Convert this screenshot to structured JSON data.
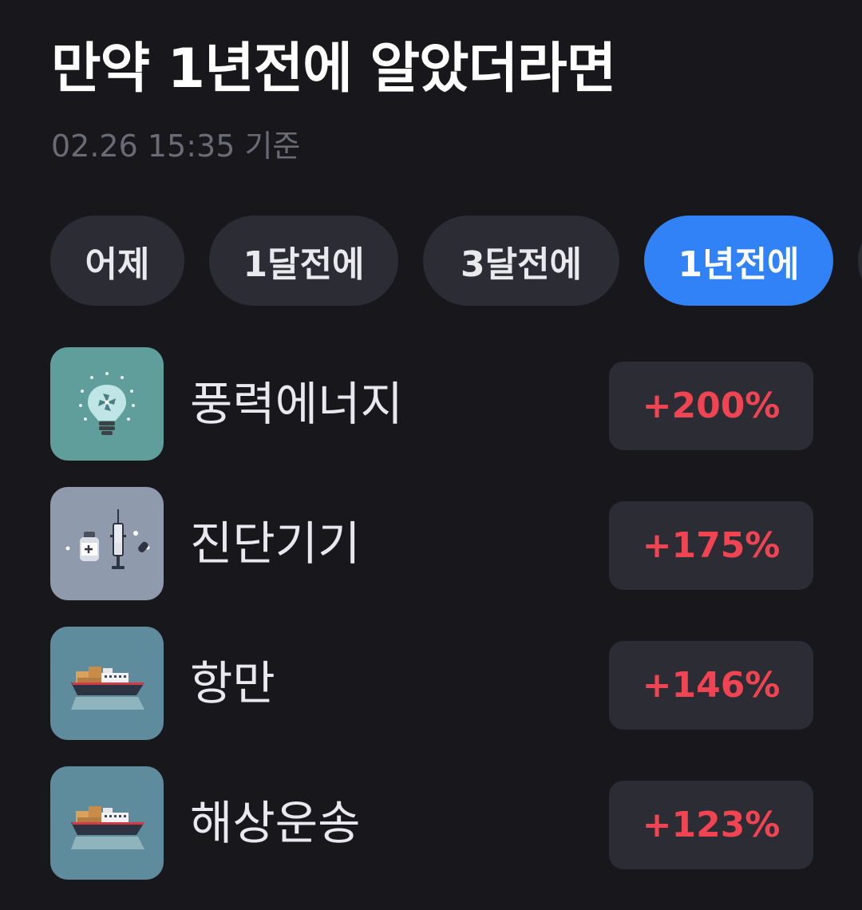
{
  "header": {
    "title": "만약 1년전에 알았더라면",
    "timestamp": "02.26 15:35 기준"
  },
  "tabs": [
    {
      "label": "어제",
      "active": false
    },
    {
      "label": "1달전에",
      "active": false
    },
    {
      "label": "3달전에",
      "active": false
    },
    {
      "label": "1년전에",
      "active": true
    }
  ],
  "items": [
    {
      "name": "풍력에너지",
      "change": "+200%",
      "icon": "wind-energy-lightbulb-icon"
    },
    {
      "name": "진단기기",
      "change": "+175%",
      "icon": "diagnostic-syringe-icon"
    },
    {
      "name": "항만",
      "change": "+146%",
      "icon": "cargo-ship-icon"
    },
    {
      "name": "해상운송",
      "change": "+123%",
      "icon": "cargo-ship-icon"
    }
  ],
  "colors": {
    "background": "#17171c",
    "accent": "#3182f6",
    "positive": "#f04452",
    "chip": "#2c2c35"
  }
}
